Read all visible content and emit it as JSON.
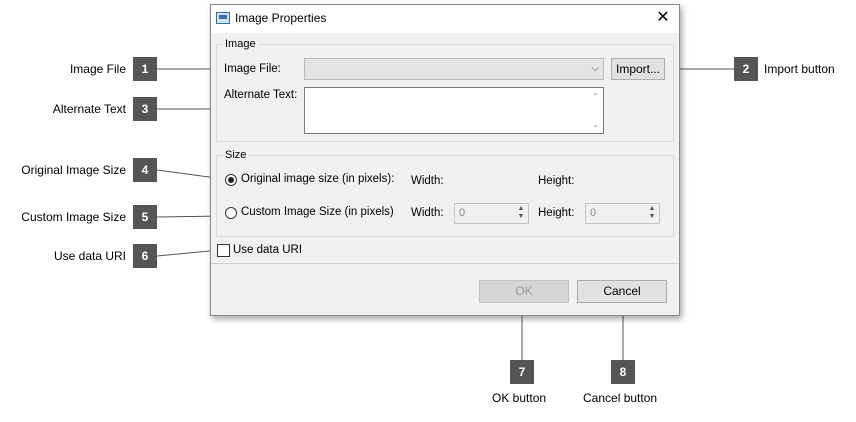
{
  "dialog": {
    "title": "Image Properties",
    "close_icon": "close-icon",
    "image_group": {
      "legend": "Image",
      "image_file_label": "Image File:",
      "image_file_value": "",
      "import_button": "Import...",
      "alternate_text_label": "Alternate Text:",
      "alternate_text_value": ""
    },
    "size_group": {
      "legend": "Size",
      "original_option": "Original image size (in pixels):",
      "custom_option": "Custom Image Size (in pixels)",
      "width_label": "Width:",
      "height_label": "Height:",
      "custom_width_value": "0",
      "custom_height_value": "0",
      "selected": "original"
    },
    "use_data_uri_label": "Use data URI",
    "use_data_uri_checked": false,
    "ok_button": "OK",
    "cancel_button": "Cancel"
  },
  "callouts": [
    {
      "number": "1",
      "label": "Image File"
    },
    {
      "number": "2",
      "label": "Import button"
    },
    {
      "number": "3",
      "label": "Alternate Text"
    },
    {
      "number": "4",
      "label": "Original Image Size"
    },
    {
      "number": "5",
      "label": "Custom Image Size"
    },
    {
      "number": "6",
      "label": "Use data URI"
    },
    {
      "number": "7",
      "label": "OK button"
    },
    {
      "number": "8",
      "label": "Cancel button"
    }
  ],
  "colors": {
    "badge": "#555555",
    "dialog_bg": "#f0f0f0",
    "disabled_text": "#9d9d9d"
  }
}
